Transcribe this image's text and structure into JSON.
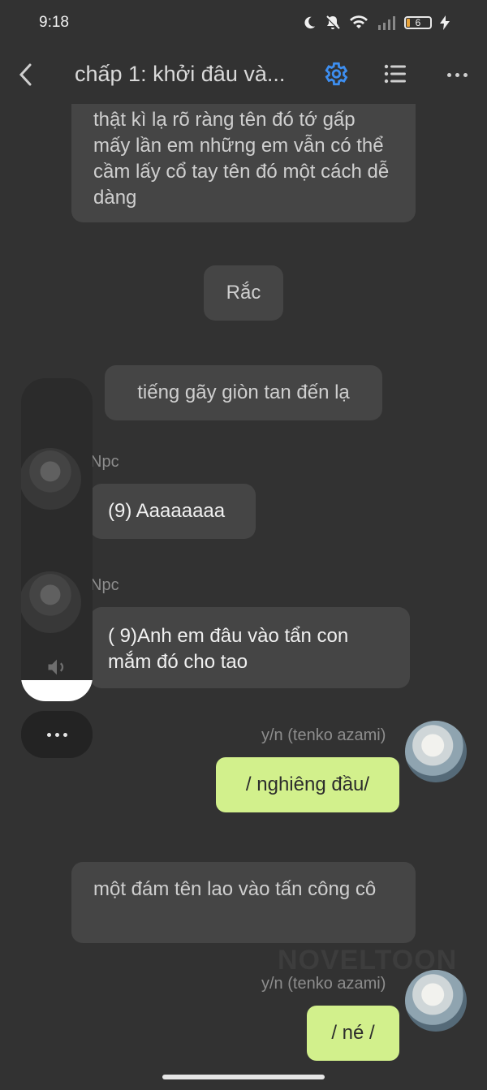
{
  "status_bar": {
    "time": "9:18",
    "battery": "6"
  },
  "header": {
    "chapter_title": "chấp 1: khởi đâu và...",
    "accent_color": "#3d8ef0"
  },
  "messages": {
    "narration_1": "thật kì lạ rõ ràng tên đó tớ gấp mấy lần em những em vẫn có thể cầm lấy cổ tay tên đó một cách dễ dàng",
    "narration_2": "Rắc",
    "narration_3": "tiếng gãy giòn tan đến lạ",
    "npc_name_1": "Npc",
    "npc_msg_1": "(9) Aaaaaaaa",
    "npc_name_2": "Npc",
    "npc_msg_2": "( 9)Anh em đâu vào tẩn con mắm đó cho tao",
    "user_name_1": "y/n (tenko azami)",
    "user_msg_1": "/ nghiêng đầu/",
    "narration_4": "một đám tên lao vào tấn công cô",
    "user_name_2": "y/n (tenko azami)",
    "user_msg_2": "/ né /"
  },
  "watermark": "NOVELTOON",
  "icons": {
    "back": "chevron-left-icon",
    "settings": "gear-icon",
    "list": "list-icon",
    "more": "more-horizontal-icon",
    "speaker": "speaker-icon",
    "dnd": "moon-icon",
    "mute": "bell-off-icon",
    "wifi": "wifi-icon",
    "signal": "signal-icon",
    "charging": "bolt-icon"
  }
}
